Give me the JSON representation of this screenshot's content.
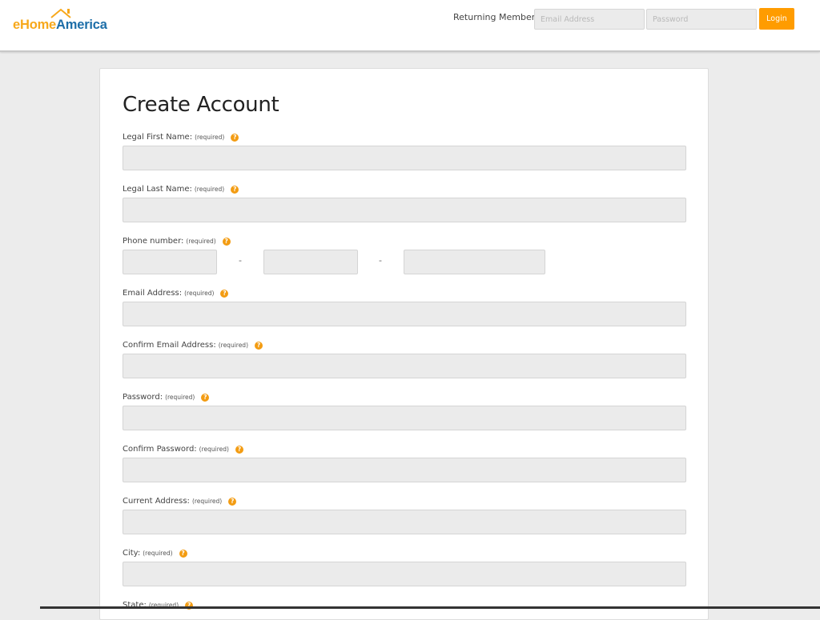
{
  "brand": {
    "logo_e": "e",
    "logo_home": "Home",
    "logo_america": "America",
    "colors": {
      "orange": "#f7a81b",
      "blue": "#1d6ea8",
      "login": "#ff9c00"
    }
  },
  "header": {
    "returning_label": "Returning Members:",
    "email_placeholder": "Email Address",
    "email_value": "",
    "password_placeholder": "Password",
    "password_value": "",
    "login_label": "Login"
  },
  "form": {
    "title": "Create Account",
    "required_text": "(required)",
    "help_glyph": "?",
    "fields": {
      "first_name": {
        "label": "Legal First Name:",
        "value": ""
      },
      "last_name": {
        "label": "Legal Last Name:",
        "value": ""
      },
      "phone": {
        "label": "Phone number:",
        "dash": "-",
        "area": "",
        "prefix": "",
        "line": ""
      },
      "email": {
        "label": "Email Address:",
        "value": ""
      },
      "confirm_email": {
        "label": "Confirm Email Address:",
        "value": ""
      },
      "password": {
        "label": "Password:",
        "value": ""
      },
      "confirm_password": {
        "label": "Confirm Password:",
        "value": ""
      },
      "current_address": {
        "label": "Current Address:",
        "value": ""
      },
      "city": {
        "label": "City:",
        "value": ""
      },
      "state": {
        "label": "State:"
      }
    }
  }
}
